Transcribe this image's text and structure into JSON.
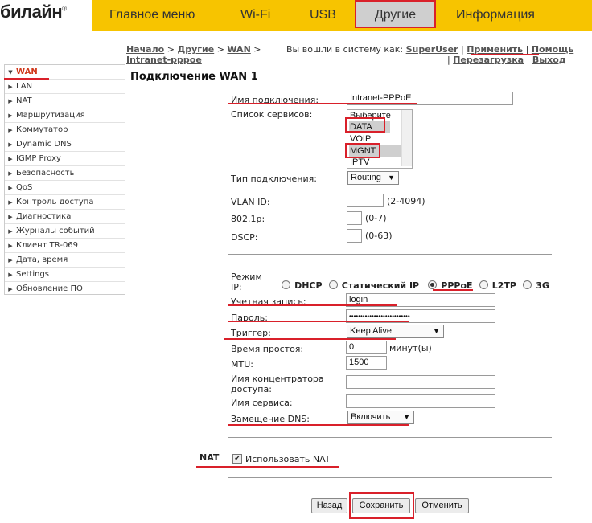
{
  "brand": {
    "logo": "билайн",
    "mark": "®"
  },
  "topnav": [
    "Главное меню",
    "Wi-Fi",
    "USB",
    "Другие",
    "Информация"
  ],
  "breadcrumb": {
    "home": "Начало",
    "other": "Другие",
    "wan": "WAN",
    "current": "Intranet-pppoe",
    "sep": ">"
  },
  "userbar": {
    "logged_in_text": "Вы вошли в систему как:",
    "user": "SuperUser",
    "apply": "Применить",
    "help": "Помощь",
    "reboot": "Перезагрузка",
    "logout": "Выход",
    "pipe": "|"
  },
  "sidebar": [
    "WAN",
    "LAN",
    "NAT",
    "Маршрутизация",
    "Коммутатор",
    "Dynamic DNS",
    "IGMP Proxy",
    "Безопасность",
    "QoS",
    "Контроль доступа",
    "Диагностика",
    "Журналы событий",
    "Клиент TR-069",
    "Дата, время",
    "Settings",
    "Обновление ПО"
  ],
  "page_title": "Подключение WAN 1",
  "form": {
    "conn_name_label": "Имя подключения:",
    "conn_name_value": "Intranet-PPPoE",
    "services_label": "Список сервисов:",
    "services": [
      "Выберите",
      "DATA",
      "VOIP",
      "MGNT",
      "IPTV"
    ],
    "conn_type_label": "Тип подключения:",
    "conn_type_value": "Routing",
    "vlan_label": "VLAN ID:",
    "vlan_hint": "(2-4094)",
    "p8021_label": "802.1p:",
    "p8021_hint": "(0-7)",
    "dscp_label": "DSCP:",
    "dscp_hint": "(0-63)",
    "ip_mode_label_1": "Режим",
    "ip_mode_label_2": "IP:",
    "ip_modes": [
      "DHCP",
      "Статический IP",
      "PPPoE",
      "L2TP",
      "3G"
    ],
    "ip_mode_selected": "PPPoE",
    "account_label": "Учетная запись:",
    "account_value": "login",
    "password_label": "Пароль:",
    "password_value": "•••••••••••••••••••••••••••",
    "trigger_label": "Триггер:",
    "trigger_value": "Keep Alive",
    "idle_label": "Время простоя:",
    "idle_value": "0",
    "idle_unit": "минут(ы)",
    "mtu_label": "MTU:",
    "mtu_value": "1500",
    "concentrator_label_1": "Имя концентратора",
    "concentrator_label_2": "доступа:",
    "service_name_label": "Имя сервиса:",
    "dns_label": "Замещение DNS:",
    "dns_value": "Включить"
  },
  "nat": {
    "section": "NAT",
    "use_label": "Использовать NAT",
    "checked": true
  },
  "buttons": {
    "back": "Назад",
    "save": "Сохранить",
    "cancel": "Отменить"
  },
  "colors": {
    "topbar": "#f7c400",
    "highlight": "#d9202a",
    "active_menu": "#d0381b"
  }
}
